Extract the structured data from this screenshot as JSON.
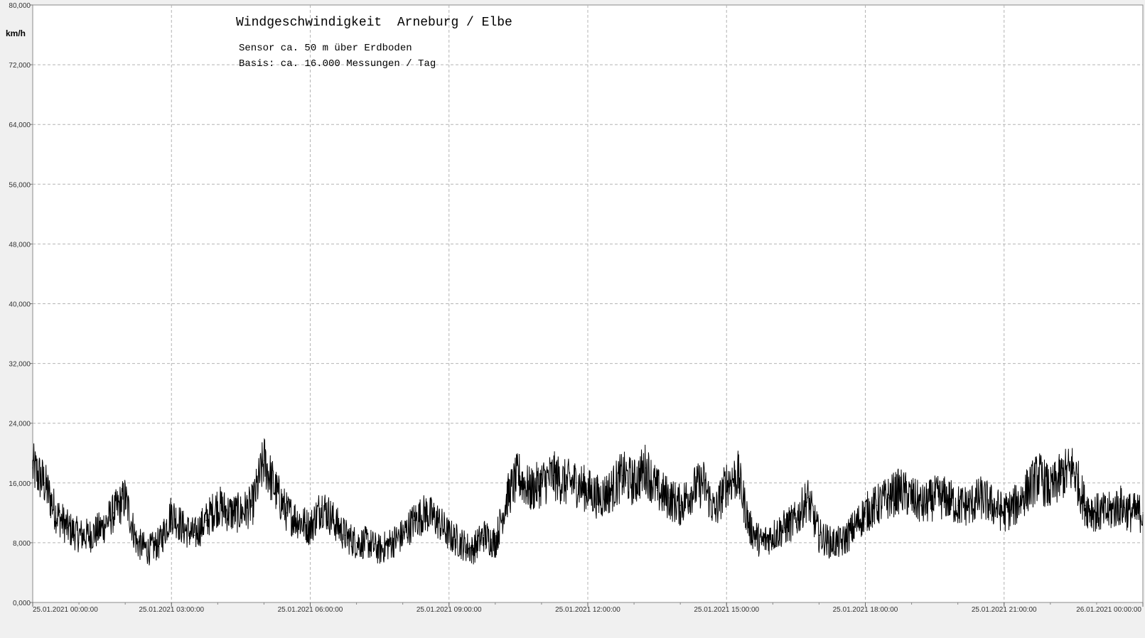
{
  "chart_data": {
    "type": "line",
    "title": "Windgeschwindigkeit  Arneburg / Elbe",
    "subtitle_lines": [
      "Sensor ca. 50 m über Erdboden",
      "Basis: ca. 16.000 Messungen / Tag"
    ],
    "ylabel": "km/h",
    "xlabel": "",
    "ylim": [
      0,
      80
    ],
    "yticks": [
      0,
      8,
      16,
      24,
      32,
      40,
      48,
      56,
      64,
      72,
      80
    ],
    "ytick_labels": [
      "0,000",
      "8,000",
      "16,000",
      "24,000",
      "32,000",
      "40,000",
      "48,000",
      "56,000",
      "64,000",
      "72,000",
      "80,000"
    ],
    "xlim_hours": [
      0,
      24
    ],
    "xticks_hours": [
      0,
      3,
      6,
      9,
      12,
      15,
      18,
      21,
      24
    ],
    "xtick_labels": [
      "25.01.2021  00:00:00",
      "25.01.2021  03:00:00",
      "25.01.2021  06:00:00",
      "25.01.2021  09:00:00",
      "25.01.2021  12:00:00",
      "25.01.2021  15:00:00",
      "25.01.2021  18:00:00",
      "25.01.2021  21:00:00",
      "26.01.2021  00:00:00"
    ],
    "grid": true,
    "legend": "none",
    "series": [
      {
        "color": "#000000",
        "x_hours": [
          0.0,
          0.25,
          0.5,
          0.75,
          1.0,
          1.25,
          1.5,
          1.75,
          2.0,
          2.25,
          2.5,
          2.75,
          3.0,
          3.25,
          3.5,
          3.75,
          4.0,
          4.25,
          4.5,
          4.75,
          5.0,
          5.25,
          5.5,
          5.75,
          6.0,
          6.25,
          6.5,
          6.75,
          7.0,
          7.25,
          7.5,
          7.75,
          8.0,
          8.25,
          8.5,
          8.75,
          9.0,
          9.25,
          9.5,
          9.75,
          10.0,
          10.25,
          10.5,
          10.75,
          11.0,
          11.25,
          11.5,
          11.75,
          12.0,
          12.25,
          12.5,
          12.75,
          13.0,
          13.25,
          13.5,
          13.75,
          14.0,
          14.25,
          14.5,
          14.75,
          15.0,
          15.25,
          15.5,
          15.75,
          16.0,
          16.25,
          16.5,
          16.75,
          17.0,
          17.25,
          17.5,
          17.75,
          18.0,
          18.25,
          18.5,
          18.75,
          19.0,
          19.25,
          19.5,
          19.75,
          20.0,
          20.25,
          20.5,
          20.75,
          21.0,
          21.25,
          21.5,
          21.75,
          22.0,
          22.25,
          22.5,
          22.75,
          23.0,
          23.25,
          23.5,
          23.75,
          24.0
        ],
        "values": [
          18,
          16,
          12,
          10,
          9,
          9,
          10,
          12,
          14,
          8,
          7,
          8,
          12,
          10,
          9,
          11,
          13,
          12,
          12,
          13,
          19,
          15,
          12,
          11,
          10,
          13,
          11,
          9,
          8,
          8,
          7,
          8,
          9,
          11,
          12,
          11,
          9,
          8,
          7,
          9,
          8,
          14,
          17,
          15,
          16,
          17,
          16,
          16,
          15,
          14,
          15,
          17,
          16,
          18,
          15,
          14,
          13,
          15,
          16,
          12,
          16,
          17,
          10,
          8,
          9,
          10,
          11,
          14,
          9,
          8,
          8,
          10,
          12,
          13,
          14,
          15,
          14,
          13,
          14,
          14,
          13,
          13,
          14,
          13,
          12,
          13,
          15,
          17,
          15,
          17,
          18,
          13,
          12,
          12,
          13,
          12,
          12
        ]
      }
    ]
  }
}
